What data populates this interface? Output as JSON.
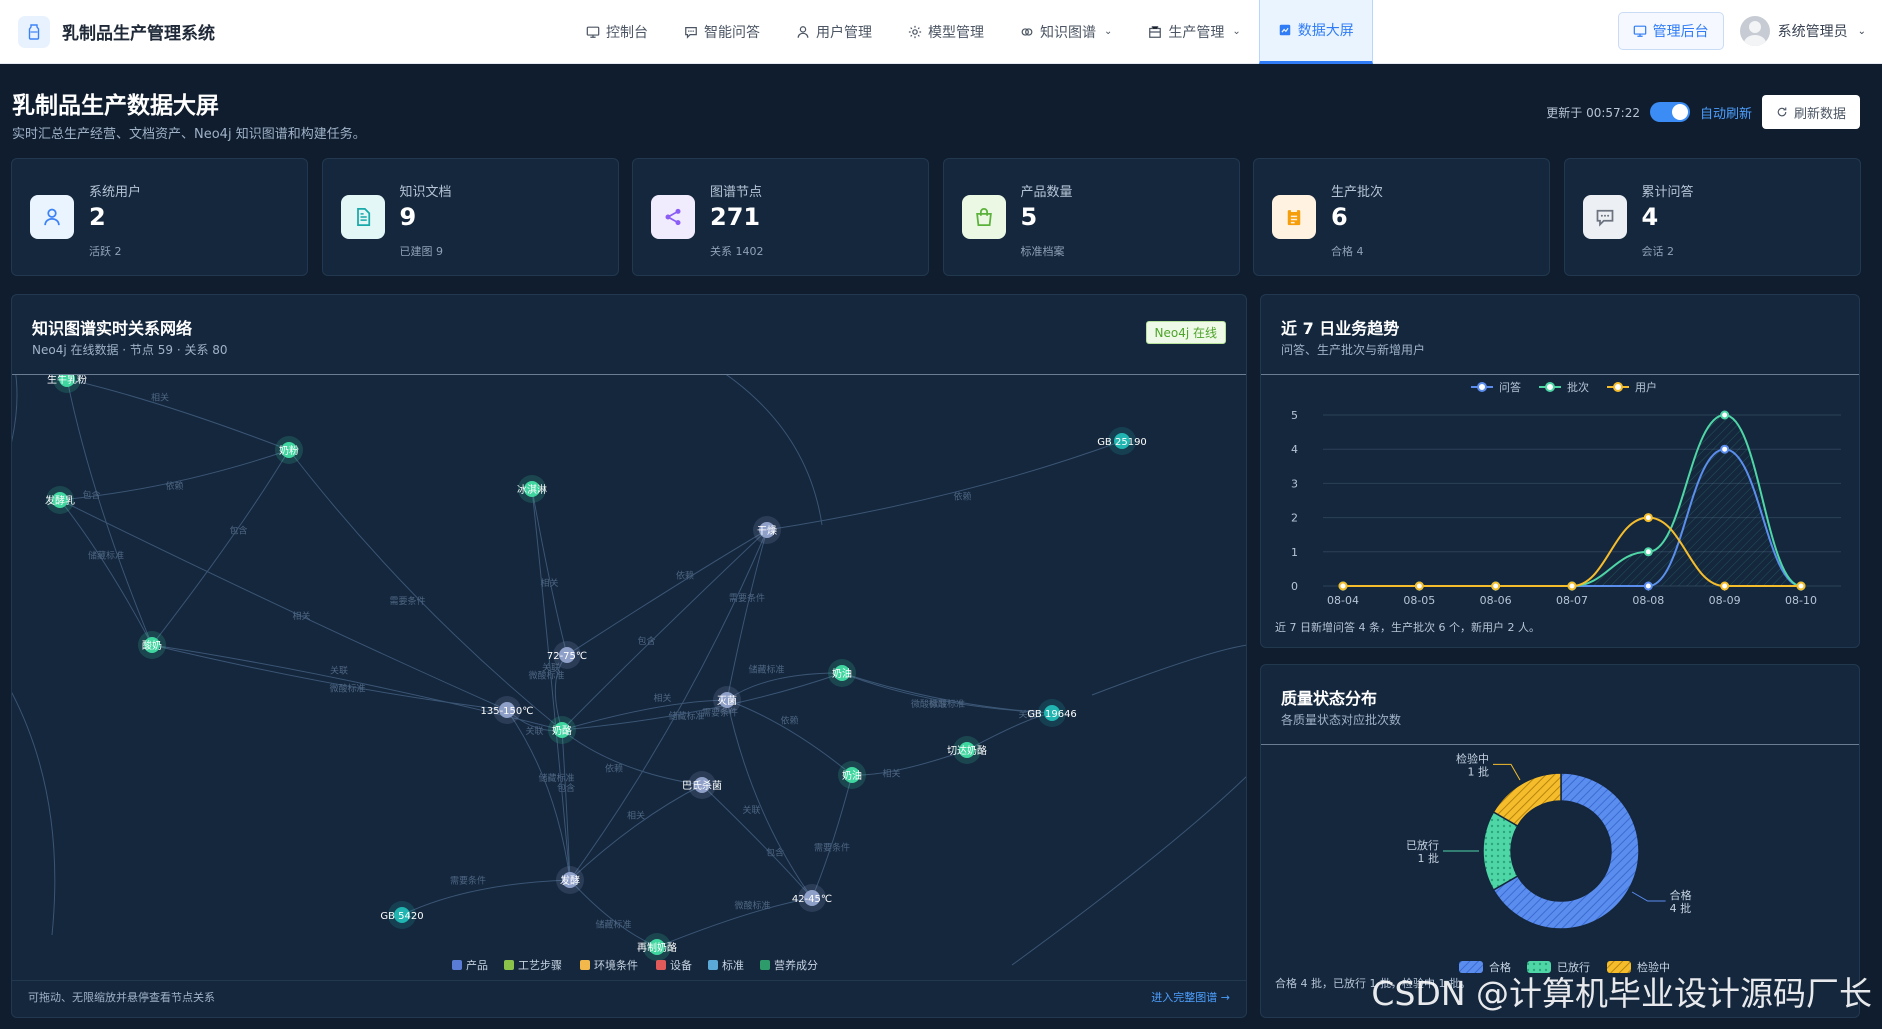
{
  "brand": {
    "title": "乳制品生产管理系统"
  },
  "nav": [
    {
      "label": "控制台",
      "icon": "monitor-icon"
    },
    {
      "label": "智能问答",
      "icon": "chat-icon"
    },
    {
      "label": "用户管理",
      "icon": "user-icon"
    },
    {
      "label": "模型管理",
      "icon": "gear-icon"
    },
    {
      "label": "知识图谱",
      "icon": "link-icon",
      "dropdown": true
    },
    {
      "label": "生产管理",
      "icon": "factory-icon",
      "dropdown": true
    },
    {
      "label": "数据大屏",
      "icon": "chart-icon",
      "active": true
    }
  ],
  "top_right": {
    "admin_label": "管理后台",
    "user_name": "系统管理员"
  },
  "header": {
    "title": "乳制品生产数据大屏",
    "subtitle": "实时汇总生产经营、文档资产、Neo4j 知识图谱和构建任务。",
    "updated": "更新于 00:57:22",
    "auto_refresh": "自动刷新",
    "refresh_button": "刷新数据"
  },
  "stats": [
    {
      "label": "系统用户",
      "value": "2",
      "sub": "活跃 2",
      "icon": "user-icon",
      "bg": "#eaf4ff",
      "fg": "#3b82f6"
    },
    {
      "label": "知识文档",
      "value": "9",
      "sub": "已建图 9",
      "icon": "document-icon",
      "bg": "#e4f7f7",
      "fg": "#18a9a9"
    },
    {
      "label": "图谱节点",
      "value": "271",
      "sub": "关系 1402",
      "icon": "share-icon",
      "bg": "#f1ecfd",
      "fg": "#8b5cf6"
    },
    {
      "label": "产品数量",
      "value": "5",
      "sub": "标准档案",
      "icon": "bag-icon",
      "bg": "#eaf8e4",
      "fg": "#5bb23a"
    },
    {
      "label": "生产批次",
      "value": "6",
      "sub": "合格 4",
      "icon": "clipboard-icon",
      "bg": "#fff2e1",
      "fg": "#f59e0b"
    },
    {
      "label": "累计问答",
      "value": "4",
      "sub": "会话 2",
      "icon": "chat-icon",
      "bg": "#eceff3",
      "fg": "#6b7280"
    }
  ],
  "graph": {
    "title": "知识图谱实时关系网络",
    "subtitle": "Neo4j 在线数据 · 节点 59 · 关系 80",
    "badge": "Neo4j 在线",
    "footer_left": "可拖动、无限缩放并悬停查看节点关系",
    "footer_right": "进入完整图谱 →",
    "nodes": [
      {
        "label": "生牛乳粉",
        "type": "product"
      },
      {
        "label": "奶粉",
        "type": "product"
      },
      {
        "label": "发酵乳",
        "type": "product"
      },
      {
        "label": "冰淇淋",
        "type": "product"
      },
      {
        "label": "干燥",
        "type": "process"
      },
      {
        "label": "GB 25190",
        "type": "standard"
      },
      {
        "label": "酸奶",
        "type": "product"
      },
      {
        "label": "72-75℃",
        "type": "env"
      },
      {
        "label": "135-150℃",
        "type": "env"
      },
      {
        "label": "奶酪",
        "type": "product"
      },
      {
        "label": "灭菌",
        "type": "process"
      },
      {
        "label": "奶油",
        "type": "product"
      },
      {
        "label": "GB 19646",
        "type": "standard"
      },
      {
        "label": "切达奶酪",
        "type": "product"
      },
      {
        "label": "巴氏杀菌",
        "type": "process"
      },
      {
        "label": "奶油",
        "type": "product"
      },
      {
        "label": "发酵",
        "type": "process"
      },
      {
        "label": "42-45℃",
        "type": "env"
      },
      {
        "label": "GB 5420",
        "type": "standard"
      },
      {
        "label": "再制奶酪",
        "type": "product"
      }
    ],
    "edge_labels": [
      "相关",
      "依赖",
      "包含",
      "需要条件",
      "储藏标准",
      "微酸标准",
      "关联"
    ],
    "legend": [
      {
        "label": "产品",
        "color": "#5b7cd6"
      },
      {
        "label": "工艺步骤",
        "color": "#8bc34a"
      },
      {
        "label": "环境条件",
        "color": "#f2b84b"
      },
      {
        "label": "设备",
        "color": "#e05a5a"
      },
      {
        "label": "标准",
        "color": "#5aa9d6"
      },
      {
        "label": "营养成分",
        "color": "#2e9c6a"
      }
    ]
  },
  "trend": {
    "title": "近 7 日业务趋势",
    "subtitle": "问答、生产批次与新增用户",
    "note": "近 7 日新增问答 4 条，生产批次 6 个，新用户 2 人。"
  },
  "quality": {
    "title": "质量状态分布",
    "subtitle": "各质量状态对应批次数",
    "note": "合格 4 批，已放行 1 批，检验中 1 批。"
  },
  "chart_data": [
    {
      "type": "line",
      "x": [
        "08-04",
        "08-05",
        "08-06",
        "08-07",
        "08-08",
        "08-09",
        "08-10"
      ],
      "series": [
        {
          "name": "问答",
          "values": [
            0,
            0,
            0,
            0,
            0,
            4,
            0
          ],
          "color": "#5b8def"
        },
        {
          "name": "批次",
          "values": [
            0,
            0,
            0,
            0,
            1,
            5,
            0
          ],
          "color": "#4fd6a6"
        },
        {
          "name": "用户",
          "values": [
            0,
            0,
            0,
            0,
            2,
            0,
            0
          ],
          "color": "#f5bd2c"
        }
      ],
      "ylim": [
        0,
        5
      ],
      "yticks": [
        0,
        1,
        2,
        3,
        4,
        5
      ],
      "grid": true,
      "legend": "top-center"
    },
    {
      "type": "pie",
      "categories": [
        "合格",
        "已放行",
        "检验中"
      ],
      "values": [
        4,
        1,
        1
      ],
      "labels": [
        "合格\n4 批",
        "已放行\n1 批",
        "检验中\n1 批"
      ],
      "colors": [
        "#5b8def",
        "#4fd6a6",
        "#f5bd2c"
      ],
      "legend": "bottom"
    }
  ],
  "watermark": "CSDN @计算机毕业设计源码厂长"
}
